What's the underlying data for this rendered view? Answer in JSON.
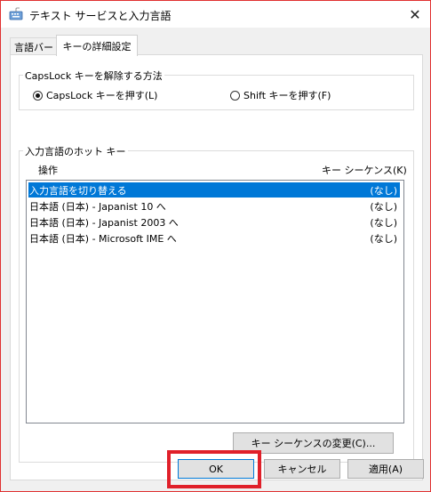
{
  "window": {
    "title": "テキスト サービスと入力言語",
    "close_glyph": "✕"
  },
  "tabs": [
    {
      "label": "言語バー"
    },
    {
      "label": "キーの詳細設定"
    }
  ],
  "capslock_group": {
    "title": "CapsLock キーを解除する方法",
    "options": [
      {
        "label": "CapsLock キーを押す(L)",
        "checked": true
      },
      {
        "label": "Shift キーを押す(F)",
        "checked": false
      }
    ]
  },
  "hotkey_group": {
    "title": "入力言語のホット キー",
    "columns": [
      "操作",
      "キー シーケンス(K)"
    ],
    "rows": [
      {
        "name": "入力言語を切り替える",
        "seq": "(なし)",
        "selected": true
      },
      {
        "name": "日本語 (日本) - Japanist 10 へ",
        "seq": "(なし)",
        "selected": false
      },
      {
        "name": "日本語 (日本) - Japanist 2003 へ",
        "seq": "(なし)",
        "selected": false
      },
      {
        "name": "日本語 (日本) - Microsoft IME へ",
        "seq": "(なし)",
        "selected": false
      }
    ],
    "change_button": "キー シーケンスの変更(C)..."
  },
  "footer": {
    "ok": "OK",
    "cancel": "キャンセル",
    "apply": "適用(A)"
  },
  "colors": {
    "selection": "#0078d7",
    "highlight": "#e0202a"
  }
}
